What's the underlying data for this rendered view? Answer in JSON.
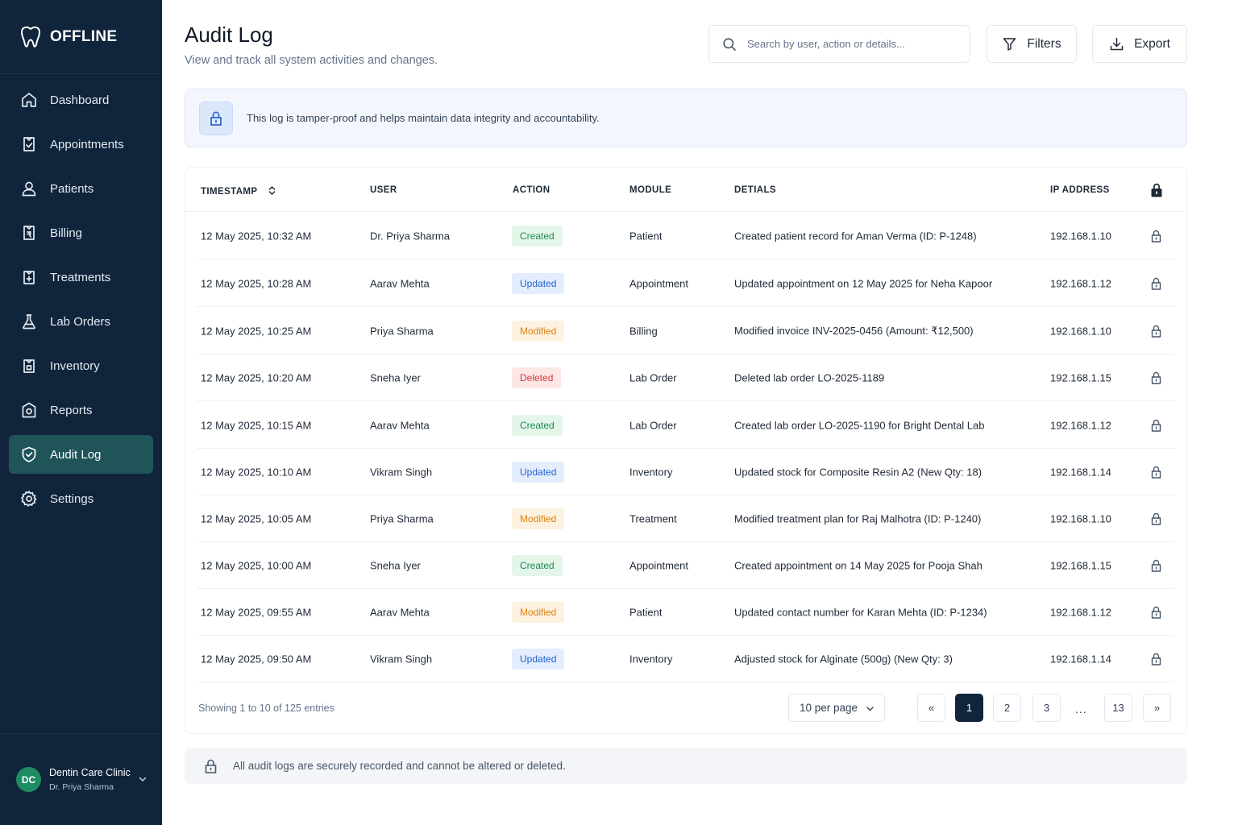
{
  "brand": {
    "name": "OFFLINE",
    "icon": "tooth-icon"
  },
  "sidebar": {
    "items": [
      {
        "label": "Dashboard",
        "icon": "home-icon",
        "active": false
      },
      {
        "label": "Appointments",
        "icon": "calendar-check-icon",
        "active": false
      },
      {
        "label": "Patients",
        "icon": "user-icon",
        "active": false
      },
      {
        "label": "Billing",
        "icon": "receipt-icon",
        "active": false
      },
      {
        "label": "Treatments",
        "icon": "clipboard-plus-icon",
        "active": false
      },
      {
        "label": "Lab Orders",
        "icon": "flask-icon",
        "active": false
      },
      {
        "label": "Inventory",
        "icon": "box-icon",
        "active": false
      },
      {
        "label": "Reports",
        "icon": "report-icon",
        "active": false
      },
      {
        "label": "Audit Log",
        "icon": "shield-check-icon",
        "active": true
      },
      {
        "label": "Settings",
        "icon": "gear-icon",
        "active": false
      }
    ],
    "footer": {
      "initials": "DC",
      "clinic": "Dentin Care Clinic",
      "user": "Dr. Priya Sharma"
    }
  },
  "header": {
    "title": "Audit Log",
    "subtitle": "View and track all system activities and changes.",
    "search_placeholder": "Search by user, action or details...",
    "filters_label": "Filters",
    "export_label": "Export"
  },
  "notice": {
    "text": "This log is tamper-proof and helps maintain data integrity and accountability."
  },
  "table": {
    "columns": [
      "TIMESTAMP",
      "USER",
      "ACTION",
      "MODULE",
      "DETIALS",
      "IP ADDRESS"
    ],
    "rows": [
      {
        "timestamp": "12 May 2025, 10:32 AM",
        "user": "Dr. Priya Sharma",
        "action": "Created",
        "module": "Patient",
        "details": "Created patient record for Aman Verma (ID: P-1248)",
        "ip": "192.168.1.10"
      },
      {
        "timestamp": "12 May 2025, 10:28 AM",
        "user": "Aarav Mehta",
        "action": "Updated",
        "module": "Appointment",
        "details": "Updated appointment on 12 May 2025 for Neha Kapoor",
        "ip": "192.168.1.12"
      },
      {
        "timestamp": "12 May 2025, 10:25 AM",
        "user": "Priya Sharma",
        "action": "Modified",
        "module": "Billing",
        "details": "Modified invoice INV-2025-0456 (Amount: ₹12,500)",
        "ip": "192.168.1.10"
      },
      {
        "timestamp": "12 May 2025, 10:20 AM",
        "user": "Sneha Iyer",
        "action": "Deleted",
        "module": "Lab Order",
        "details": "Deleted lab order LO-2025-1189",
        "ip": "192.168.1.15"
      },
      {
        "timestamp": "12 May 2025, 10:15 AM",
        "user": "Aarav Mehta",
        "action": "Created",
        "module": "Lab Order",
        "details": "Created lab order LO-2025-1190 for Bright Dental Lab",
        "ip": "192.168.1.12"
      },
      {
        "timestamp": "12 May 2025, 10:10 AM",
        "user": "Vikram Singh",
        "action": "Updated",
        "module": "Inventory",
        "details": "Updated stock for Composite Resin A2 (New Qty: 18)",
        "ip": "192.168.1.14"
      },
      {
        "timestamp": "12 May 2025, 10:05 AM",
        "user": "Priya Sharma",
        "action": "Modified",
        "module": "Treatment",
        "details": "Modified treatment plan for Raj Malhotra (ID: P-1240)",
        "ip": "192.168.1.10"
      },
      {
        "timestamp": "12 May 2025, 10:00 AM",
        "user": "Sneha Iyer",
        "action": "Created",
        "module": "Appointment",
        "details": "Created appointment on 14 May 2025 for Pooja Shah",
        "ip": "192.168.1.15"
      },
      {
        "timestamp": "12 May 2025, 09:55 AM",
        "user": "Aarav Mehta",
        "action": "Modified",
        "module": "Patient",
        "details": "Updated contact number for Karan Mehta (ID: P-1234)",
        "ip": "192.168.1.12"
      },
      {
        "timestamp": "12 May 2025, 09:50 AM",
        "user": "Vikram Singh",
        "action": "Updated",
        "module": "Inventory",
        "details": "Adjusted stock for Alginate (500g) (New Qty: 3)",
        "ip": "192.168.1.14"
      }
    ],
    "footer_text": "Showing 1 to 10 of 125 entries",
    "per_page": "10 per page",
    "pagination": {
      "prev": "«",
      "pages": [
        "1",
        "2",
        "3"
      ],
      "ellipsis": "...",
      "last": "13",
      "next": "»",
      "current": "1"
    }
  },
  "bottom_note": "All audit logs are securely recorded and cannot be altered or deleted.",
  "colors": {
    "sidebar_bg": "#10243b",
    "active_nav": "#1f5459",
    "created": "#1a8a4f",
    "updated": "#2563c9",
    "modified": "#d98316",
    "deleted": "#d43a3a"
  }
}
